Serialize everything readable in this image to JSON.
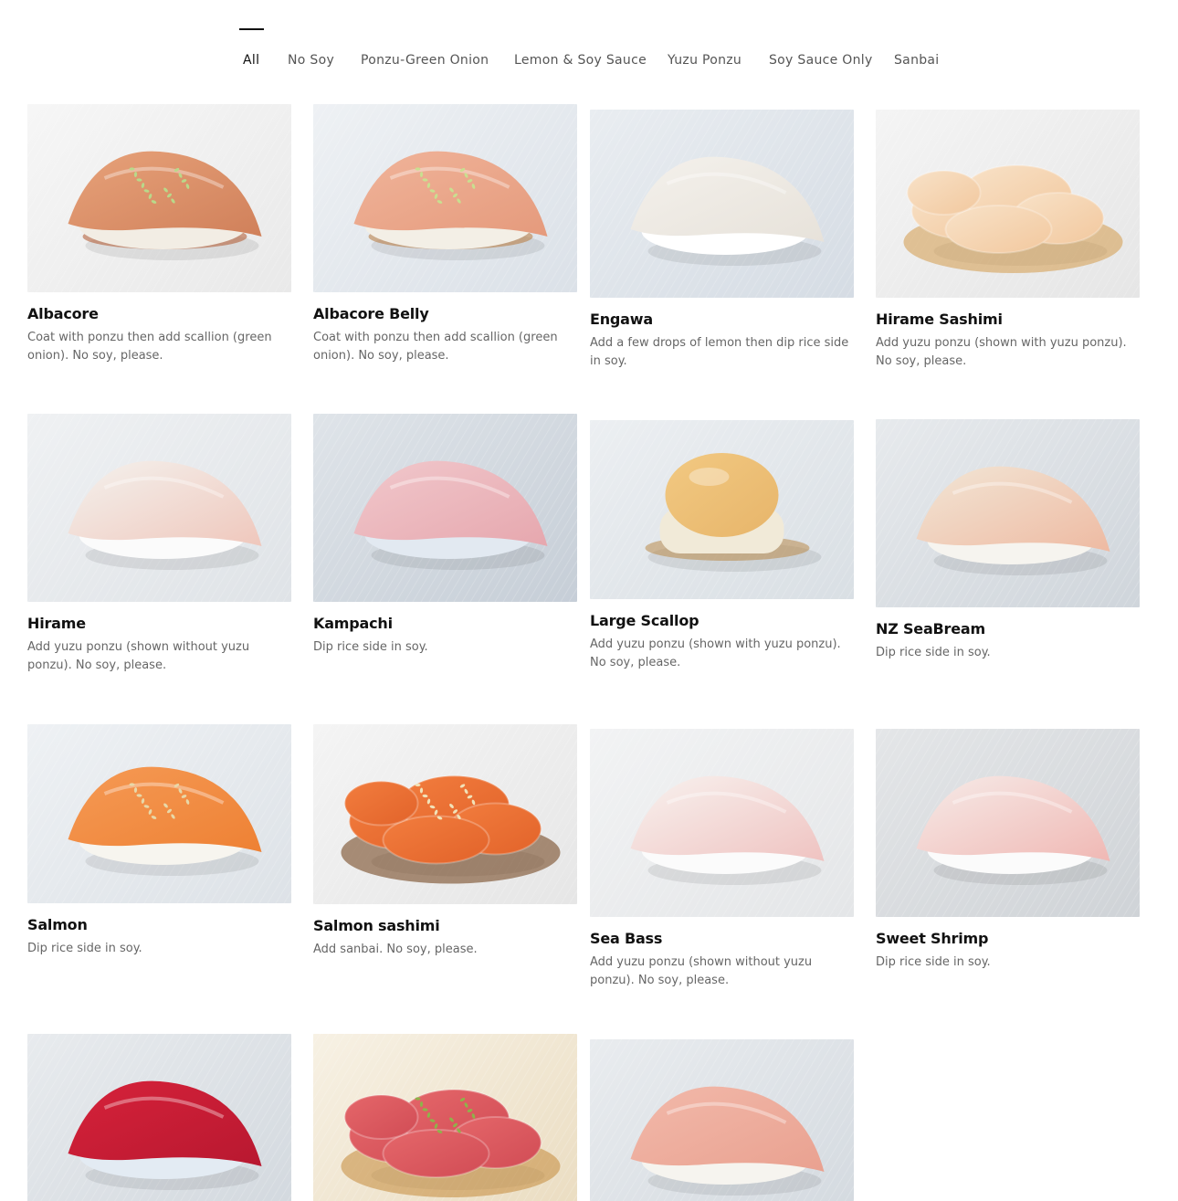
{
  "filters": {
    "items": [
      {
        "label": "All",
        "active": true
      },
      {
        "label": "No Soy"
      },
      {
        "label": "Ponzu-Green Onion"
      },
      {
        "label": "Lemon & Soy Sauce"
      },
      {
        "label": "Yuzu Ponzu"
      },
      {
        "label": "Soy Sauce Only"
      },
      {
        "label": "Sanbai"
      }
    ]
  },
  "items": [
    {
      "name": "Albacore",
      "description": "Coat with ponzu then add scallion (green onion). No soy, please.",
      "image": "albacore-nigiri"
    },
    {
      "name": "Albacore Belly",
      "description": "Coat with ponzu then add scallion (green onion). No soy, please.",
      "image": "albacore-belly-nigiri"
    },
    {
      "name": "Engawa",
      "description": "Add a few drops of lemon then dip rice side in soy.",
      "image": "engawa-nigiri"
    },
    {
      "name": "Hirame Sashimi",
      "description": "Add yuzu ponzu (shown with yuzu ponzu). No soy, please.",
      "image": "hirame-sashimi"
    },
    {
      "name": "Hirame",
      "description": "Add yuzu ponzu (shown without yuzu ponzu). No soy, please.",
      "image": "hirame-nigiri"
    },
    {
      "name": "Kampachi",
      "description": "Dip rice side in soy.",
      "image": "kampachi-nigiri"
    },
    {
      "name": "Large Scallop",
      "description": "Add yuzu ponzu (shown with yuzu ponzu). No soy, please.",
      "image": "scallop-nigiri"
    },
    {
      "name": "NZ SeaBream",
      "description": "Dip rice side in soy.",
      "image": "seabream-nigiri"
    },
    {
      "name": "Salmon",
      "description": "Dip rice side in soy.",
      "image": "salmon-nigiri"
    },
    {
      "name": "Salmon sashimi",
      "description": "Add sanbai. No soy, please.",
      "image": "salmon-sashimi"
    },
    {
      "name": "Sea Bass",
      "description": "Add yuzu ponzu (shown without yuzu ponzu). No soy, please.",
      "image": "seabass-nigiri"
    },
    {
      "name": "Sweet Shrimp",
      "description": "Dip rice side in soy.",
      "image": "sweet-shrimp-nigiri"
    },
    {
      "name": "",
      "description": "",
      "image": "tuna-nigiri"
    },
    {
      "name": "",
      "description": "",
      "image": "tuna-sashimi"
    },
    {
      "name": "",
      "description": "",
      "image": "yellowtail-nigiri"
    }
  ],
  "colors": {
    "text_primary": "#111111",
    "text_secondary": "#666666",
    "plate": "#e8ebef"
  }
}
